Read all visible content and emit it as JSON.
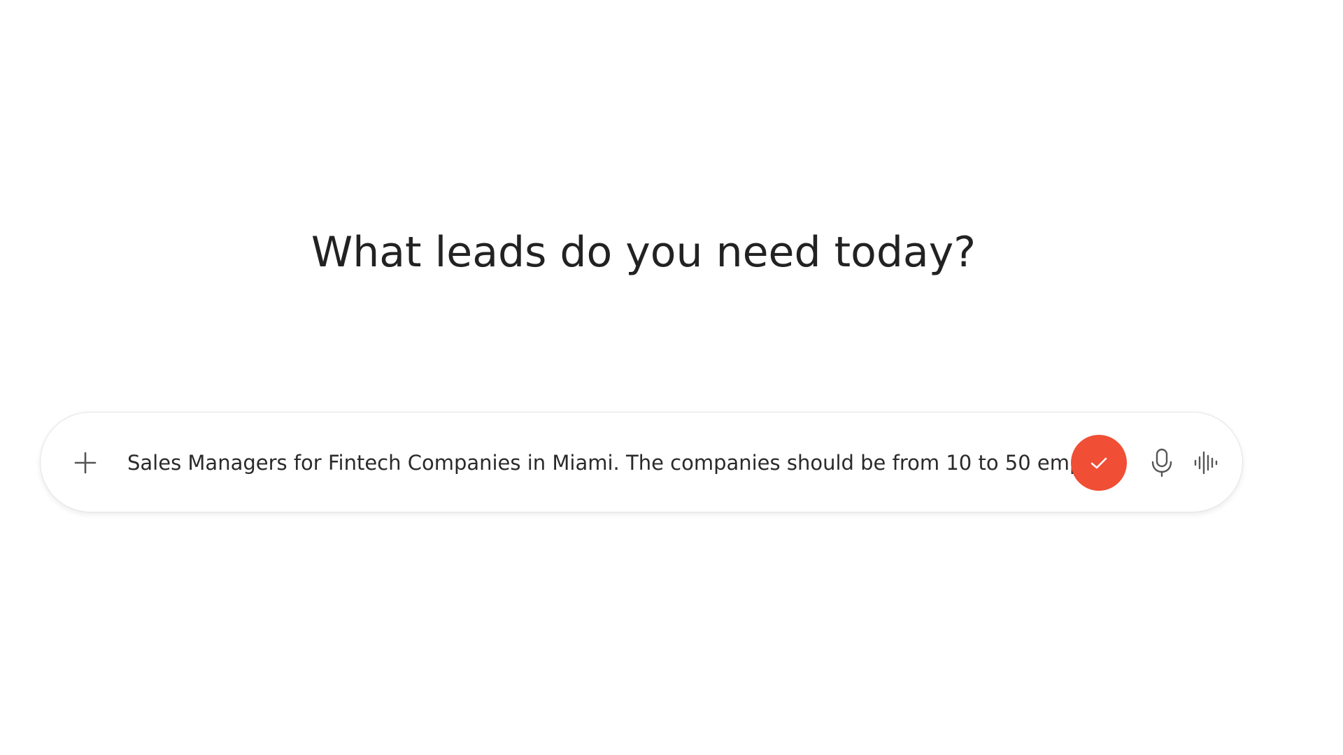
{
  "heading": {
    "title": "What leads do you need today?"
  },
  "composer": {
    "input_value": "Sales Managers for Fintech Companies in Miami. The companies should be from 10 to 50 empl",
    "icons": {
      "add": "plus-icon",
      "send": "checkmark-icon",
      "mic": "microphone-icon",
      "voice": "audio-waveform-icon"
    }
  },
  "colors": {
    "accent": "#f04e35",
    "text": "#222222",
    "icon": "#555555",
    "border": "#e4e4e4",
    "background": "#ffffff"
  }
}
